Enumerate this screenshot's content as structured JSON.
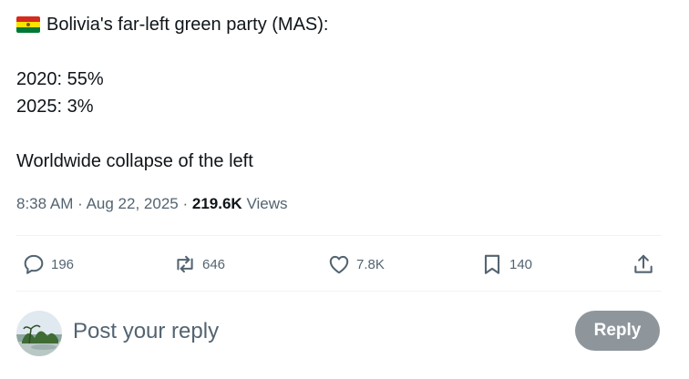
{
  "post": {
    "flag_icon": "bolivia-flag-emoji",
    "line1": "Bolivia's far-left green party (MAS):",
    "line2": "2020: 55%",
    "line3": "2025: 3%",
    "line4": "Worldwide collapse of the left"
  },
  "meta": {
    "time": "8:38 AM",
    "sep1": "·",
    "date": "Aug 22, 2025",
    "sep2": "·",
    "views_count": "219.6K",
    "views_label": "Views"
  },
  "actions": {
    "replies": "196",
    "reposts": "646",
    "likes": "7.8K",
    "bookmarks": "140"
  },
  "reply_box": {
    "placeholder": "Post your reply",
    "button_label": "Reply"
  },
  "colors": {
    "text": "#0f1419",
    "secondary": "#536471",
    "divider": "#eff3f4",
    "reply_button_disabled": "#8e969c",
    "flag_red": "#d52b1e",
    "flag_yellow": "#f9e300",
    "flag_green": "#007934"
  }
}
